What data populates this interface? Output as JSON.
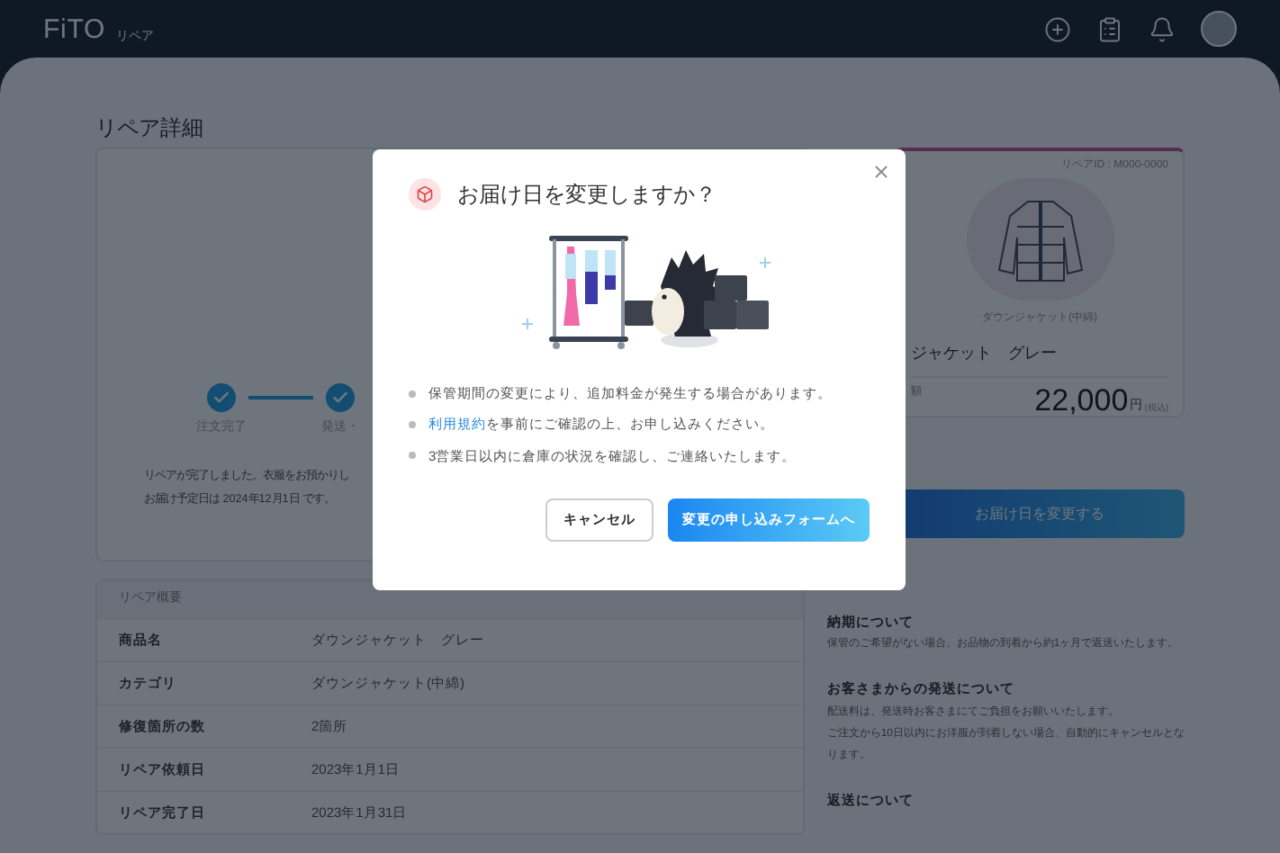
{
  "header": {
    "logo": "FiTO",
    "section": "リペア"
  },
  "page_title": "リペア詳細",
  "progress": {
    "steps": [
      {
        "label": "注文完了",
        "done": true
      },
      {
        "label": "発送・",
        "done": true
      }
    ],
    "message_lines": [
      "リペアが完了しました。衣服をお預かりし",
      "お届け予定日は 2024年12月1日 です。"
    ]
  },
  "item_card": {
    "repair_id": "リペアID : M000-0000",
    "caption": "ダウンジャケット(中綿)",
    "name": "ジャケット　グレー",
    "price_label": "額",
    "price": "22,000",
    "currency": "円",
    "tax_note": "(税込)"
  },
  "change_button": "お届け日を変更する",
  "summary": {
    "title": "リペア概要",
    "rows": [
      {
        "label": "商品名",
        "value": "ダウンジャケット　グレー"
      },
      {
        "label": "カテゴリ",
        "value": "ダウンジャケット(中綿)"
      },
      {
        "label": "修復箇所の数",
        "value": "2箇所"
      },
      {
        "label": "リペア依頼日",
        "value": "2023年1月1日"
      },
      {
        "label": "リペア完了日",
        "value": "2023年1月31日"
      }
    ]
  },
  "info": [
    {
      "heading": "納期について",
      "lines": [
        "保管のご希望がない場合、お品物の到着から約1ヶ月で返送いたします。"
      ]
    },
    {
      "heading": "お客さまからの発送について",
      "lines": [
        "配送料は、発送時お客さまにてご負担をお願いいたします。",
        "ご注文から10日以内にお洋服が到着しない場合、自動的にキャンセルとな",
        "ります。"
      ]
    },
    {
      "heading": "返送について"
    }
  ],
  "dialog": {
    "title": "お届け日を変更しますか？",
    "notes": [
      {
        "text": "保管期間の変更により、追加料金が発生する場合があります。"
      },
      {
        "link": "利用規約",
        "text": "を事前にご確認の上、お申し込みください。"
      },
      {
        "text": "3営業日以内に倉庫の状況を確認し、ご連絡いたします。"
      }
    ],
    "cancel": "キャンセル",
    "confirm": "変更の申し込みフォームへ"
  }
}
